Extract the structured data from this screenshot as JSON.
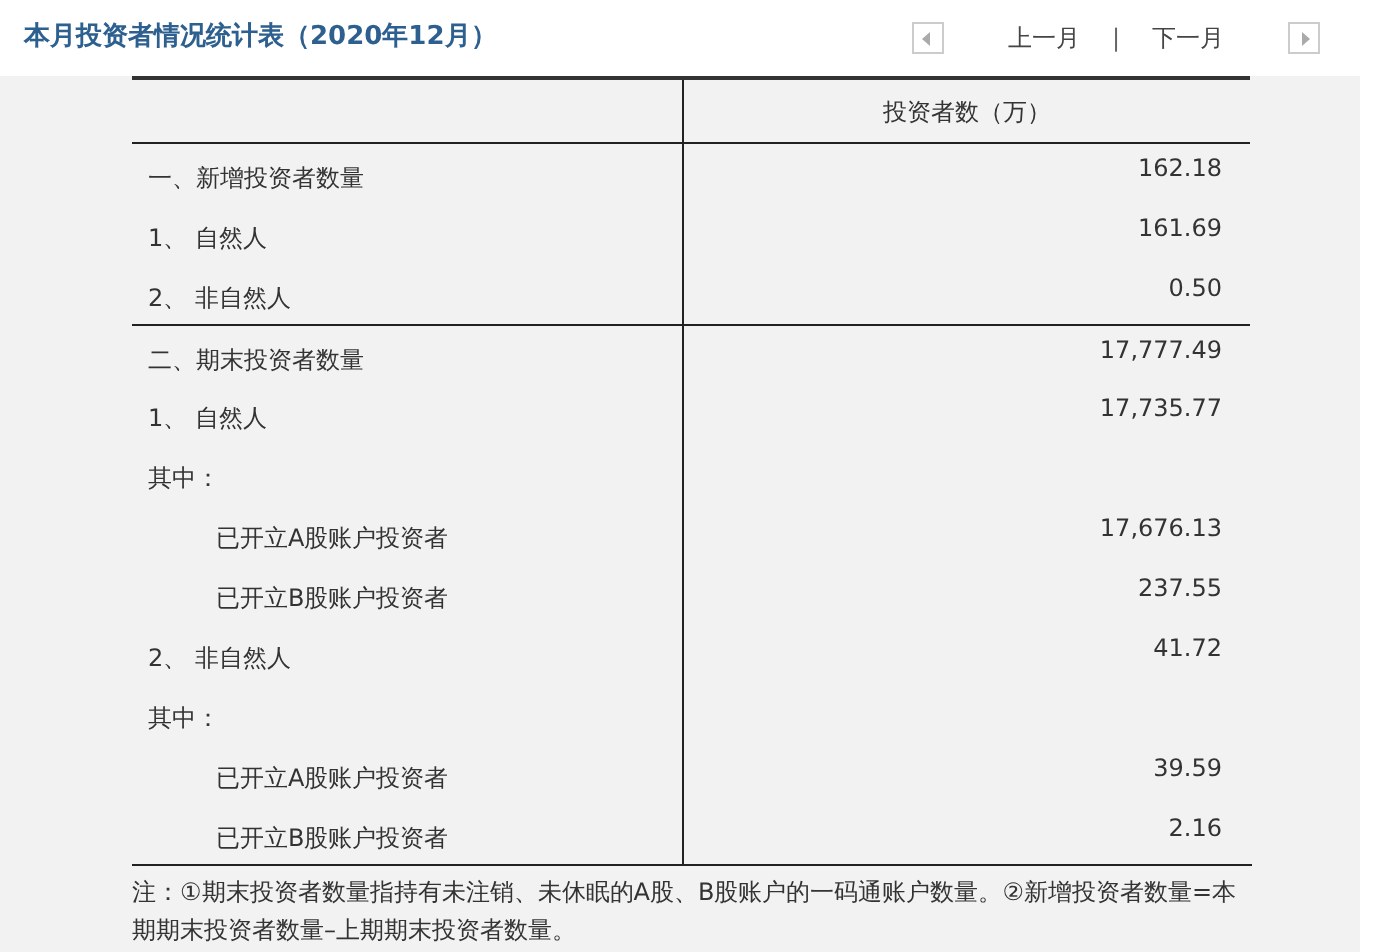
{
  "title": "本月投资者情况统计表（2020年12月）",
  "nav": {
    "prev": "上一月",
    "separator": "|",
    "next": "下一月"
  },
  "table": {
    "columns": [
      "",
      "投资者数（万）"
    ],
    "rows": [
      {
        "kind": "section",
        "label": "一、新增投资者数量",
        "value": "162.18"
      },
      {
        "kind": "item",
        "label": "1、 自然人",
        "value": "161.69"
      },
      {
        "kind": "item",
        "label": "2、 非自然人",
        "value": "0.50"
      },
      {
        "kind": "section",
        "label": "二、期末投资者数量",
        "value": "17,777.49"
      },
      {
        "kind": "item",
        "label": "1、 自然人",
        "value": "17,735.77"
      },
      {
        "kind": "item",
        "label": "其中：",
        "value": ""
      },
      {
        "kind": "subitem",
        "label": "已开立A股账户投资者",
        "value": "17,676.13"
      },
      {
        "kind": "subitem",
        "label": "已开立B股账户投资者",
        "value": "237.55"
      },
      {
        "kind": "item",
        "label": "2、 非自然人",
        "value": "41.72"
      },
      {
        "kind": "item",
        "label": "其中：",
        "value": ""
      },
      {
        "kind": "subitem",
        "label": "已开立A股账户投资者",
        "value": "39.59"
      },
      {
        "kind": "subitem",
        "label": "已开立B股账户投资者",
        "value": "2.16"
      }
    ]
  },
  "footnote": "注：①期末投资者数量指持有未注销、未休眠的A股、B股账户的一码通账户数量。②新增投资者数量=本期期末投资者数量–上期期末投资者数量。"
}
